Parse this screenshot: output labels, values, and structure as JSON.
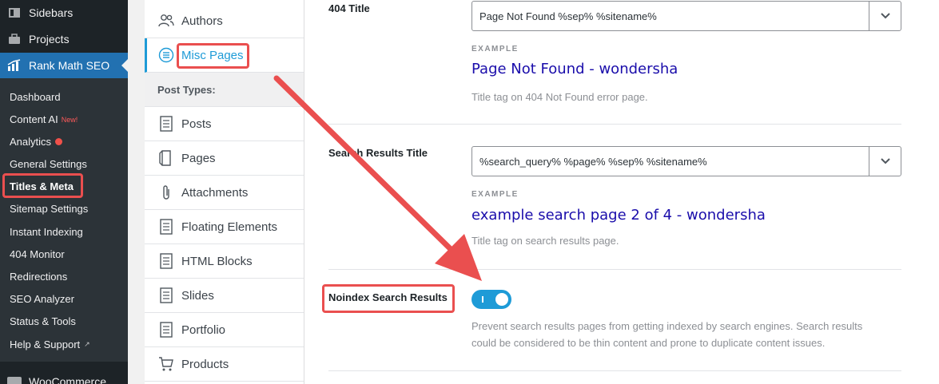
{
  "wp_menu": {
    "top_items": [
      {
        "label": "Sidebars",
        "icon": "sidebars-icon"
      },
      {
        "label": "Projects",
        "icon": "briefcase-icon"
      },
      {
        "label": "Rank Math SEO",
        "icon": "rank-math-icon"
      }
    ],
    "bottom_item": {
      "label": "WooCommerce",
      "icon": "woocommerce-icon"
    },
    "submenu": [
      {
        "label": "Dashboard"
      },
      {
        "label": "Content AI",
        "badge": "New!"
      },
      {
        "label": "Analytics"
      },
      {
        "label": "General Settings"
      },
      {
        "label": "Titles & Meta"
      },
      {
        "label": "Sitemap Settings"
      },
      {
        "label": "Instant Indexing"
      },
      {
        "label": "404 Monitor"
      },
      {
        "label": "Redirections"
      },
      {
        "label": "SEO Analyzer"
      },
      {
        "label": "Status & Tools"
      },
      {
        "label": "Help & Support"
      }
    ],
    "colors": {
      "sidebar_bg": "#1d2327",
      "active_bg": "#2271b1",
      "analytics_dot": "#f0514a"
    }
  },
  "tabs": {
    "authors": {
      "label": "Authors",
      "icon": "authors-icon"
    },
    "misc_pages": {
      "label": "Misc Pages",
      "icon": "list-circle-icon"
    },
    "post_types_header": "Post Types:",
    "post_types": [
      {
        "label": "Posts",
        "icon": "document-icon"
      },
      {
        "label": "Pages",
        "icon": "page-icon"
      },
      {
        "label": "Attachments",
        "icon": "paperclip-icon"
      },
      {
        "label": "Floating Elements",
        "icon": "document-icon"
      },
      {
        "label": "HTML Blocks",
        "icon": "document-icon"
      },
      {
        "label": "Slides",
        "icon": "document-icon"
      },
      {
        "label": "Portfolio",
        "icon": "document-icon"
      },
      {
        "label": "Products",
        "icon": "cart-icon"
      }
    ]
  },
  "settings": {
    "title_404": {
      "label": "404 Title",
      "value": "Page Not Found %sep% %sitename%",
      "example_label": "EXAMPLE",
      "example_value": "Page Not Found - wondersha",
      "help": "Title tag on 404 Not Found error page."
    },
    "search_title": {
      "label": "Search Results Title",
      "value": "%search_query% %page% %sep% %sitename%",
      "example_label": "EXAMPLE",
      "example_value": "example search page 2 of 4 - wondersha",
      "help": "Title tag on search results page."
    },
    "noindex_search": {
      "label": "Noindex Search Results",
      "enabled": true,
      "help_line1": "Prevent search results pages from getting indexed by search engines. Search results",
      "help_line2": "could be considered to be thin content and prone to duplicate content issues."
    }
  },
  "colors": {
    "accent": "#1e9bd7",
    "annotation": "#ea4f4f",
    "example_link": "#1a0dab"
  }
}
